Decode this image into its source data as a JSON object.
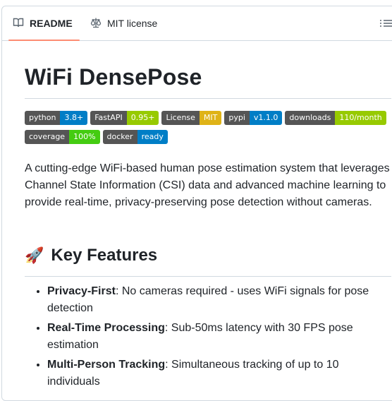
{
  "tabs": {
    "readme": "README",
    "license": "MIT license"
  },
  "title": "WiFi DensePose",
  "badges": [
    {
      "label": "python",
      "value": "3.8+",
      "color": "#007ec6"
    },
    {
      "label": "FastAPI",
      "value": "0.95+",
      "color": "#97ca00"
    },
    {
      "label": "License",
      "value": "MIT",
      "color": "#dfb317"
    },
    {
      "label": "pypi",
      "value": "v1.1.0",
      "color": "#007ec6"
    },
    {
      "label": "downloads",
      "value": "110/month",
      "color": "#97ca00"
    },
    {
      "label": "coverage",
      "value": "100%",
      "color": "#4c1"
    },
    {
      "label": "docker",
      "value": "ready",
      "color": "#007ec6"
    }
  ],
  "intro": "A cutting-edge WiFi-based human pose estimation system that leverages Channel State Information (CSI) data and advanced machine learning to provide real-time, privacy-preserving pose detection without cameras.",
  "features_heading": "Key Features",
  "features_emoji": "🚀",
  "features": [
    {
      "title": "Privacy-First",
      "text": ": No cameras required - uses WiFi signals for pose detection"
    },
    {
      "title": "Real-Time Processing",
      "text": ": Sub-50ms latency with 30 FPS pose estimation"
    },
    {
      "title": "Multi-Person Tracking",
      "text": ": Simultaneous tracking of up to 10 individuals"
    }
  ]
}
